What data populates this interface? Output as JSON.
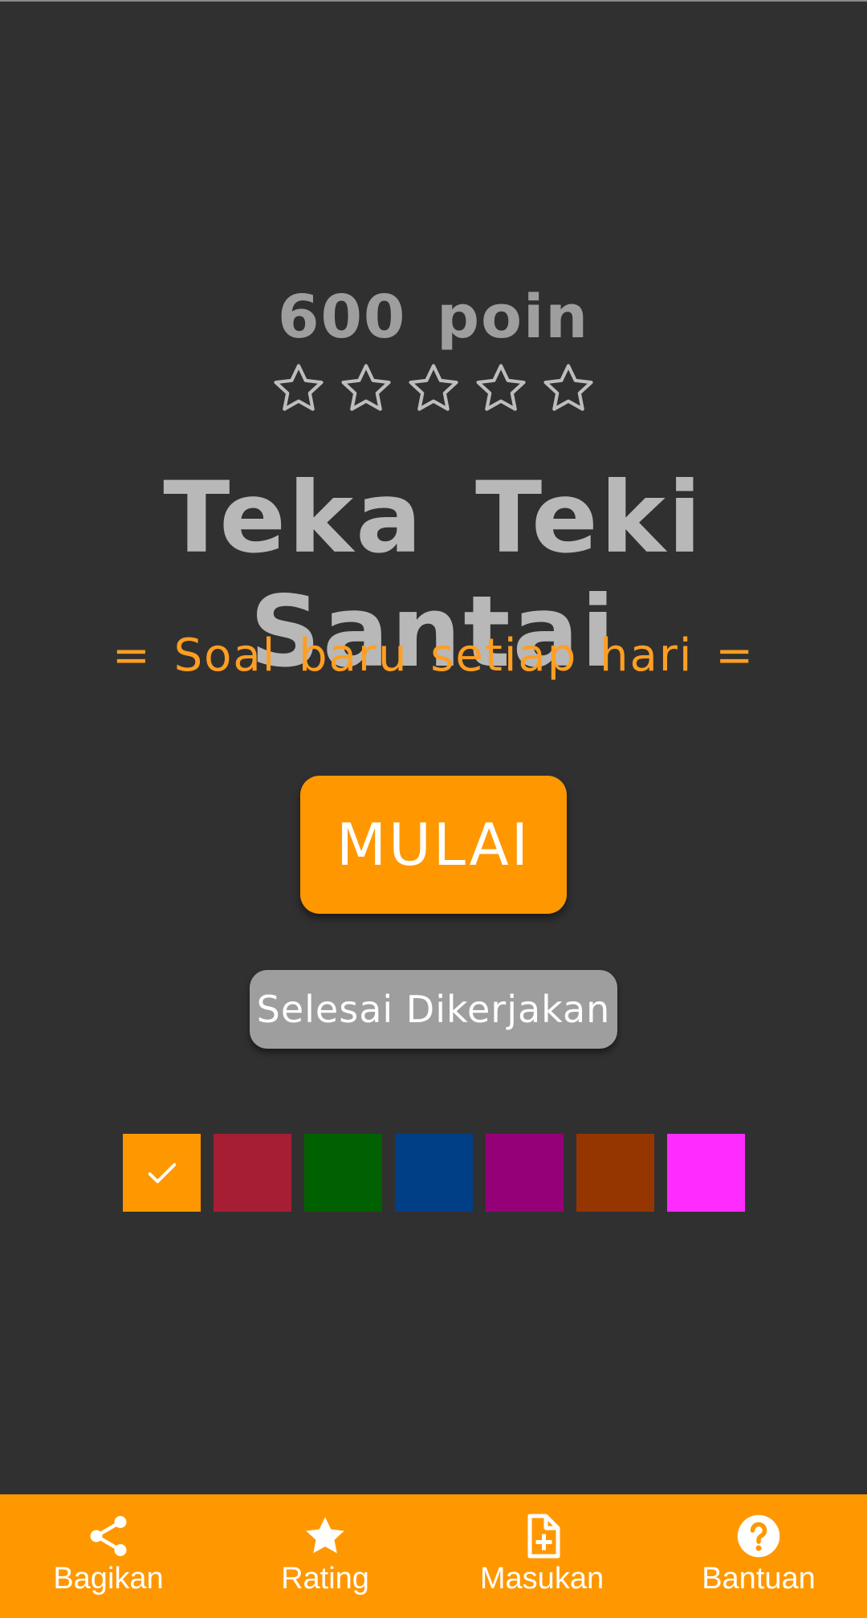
{
  "header": {
    "points_text": "600 poin",
    "stars_total": 5,
    "stars_filled": 0
  },
  "title": "Teka Teki Santai",
  "subtitle": "= Soal baru setiap hari =",
  "buttons": {
    "start_label": "MULAI",
    "done_label": "Selesai Dikerjakan"
  },
  "themes": {
    "selected_index": 0,
    "colors": [
      "#ff9800",
      "#a51e33",
      "#006100",
      "#003f86",
      "#950078",
      "#953600",
      "#ff2bff"
    ]
  },
  "bottom_nav": [
    {
      "label": "Bagikan",
      "icon": "share-icon"
    },
    {
      "label": "Rating",
      "icon": "star-icon"
    },
    {
      "label": "Masukan",
      "icon": "note-add-icon"
    },
    {
      "label": "Bantuan",
      "icon": "help-icon"
    }
  ],
  "colors": {
    "background": "#313031",
    "accent": "#ff9800",
    "subtitle": "#ff9f22",
    "muted_text": "#9e9e9e",
    "title_text": "#b8b8b8"
  }
}
